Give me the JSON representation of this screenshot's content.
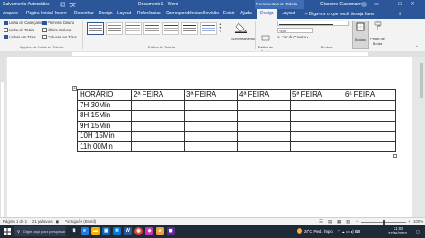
{
  "title_bar": {
    "autosave_label": "Salvamento Automático",
    "document_title": "Documento1 - Word",
    "context_title": "Ferramentas de Tabela",
    "user_name": "Giacomo Giacomann",
    "colors": {
      "bar": "#2b579a",
      "context_band": "#3e6db5"
    }
  },
  "tabs": [
    {
      "label": "Arquivo"
    },
    {
      "label": "Página Inicial"
    },
    {
      "label": "Inserir"
    },
    {
      "label": "Desenhar"
    },
    {
      "label": "Design"
    },
    {
      "label": "Layout"
    },
    {
      "label": "Referências"
    },
    {
      "label": "Correspondências"
    },
    {
      "label": "Revisão"
    },
    {
      "label": "Exibir"
    },
    {
      "label": "Ajuda"
    },
    {
      "label": "Design",
      "active": true
    },
    {
      "label": "Layout"
    }
  ],
  "search": {
    "text": "Diga-me o que você deseja fazer"
  },
  "share": {
    "label": "Compartilhar"
  },
  "ribbon": {
    "style_options": {
      "items": [
        {
          "label": "Linha de Cabeçalho",
          "checked": true
        },
        {
          "label": "Primeira Coluna",
          "checked": true
        },
        {
          "label": "Linha de Totais",
          "checked": false
        },
        {
          "label": "Última Coluna",
          "checked": false
        },
        {
          "label": "Linhas em Tiras",
          "checked": true
        },
        {
          "label": "Colunas em Tiras",
          "checked": false
        }
      ],
      "group_label": "Opções de Estilo de Tabela"
    },
    "table_styles": {
      "group_label": "Estilos de Tabela"
    },
    "shading": {
      "label": "Sombreamento"
    },
    "border_styles": {
      "label": "Estilos de Borda"
    },
    "pen_weight": "½ pt",
    "pen_color": {
      "label": "Cor da Caneta"
    },
    "borders_group_label": "Bordas",
    "borders_button": {
      "label": "Bordas"
    },
    "border_painter": {
      "label": "Pincel de Borda"
    }
  },
  "document": {
    "table": {
      "header": [
        "HORÁRIO",
        "2ª FEIRA",
        "3ª FEIRA",
        "4ª FEIRA",
        "5ª FEIRA",
        "6ª FEIRA"
      ],
      "rows": [
        [
          "7H 30Min",
          "",
          "",
          "",
          "",
          ""
        ],
        [
          "8H 15Min",
          "",
          "",
          "",
          "",
          ""
        ],
        [
          "9H 15Min",
          "",
          "",
          "",
          "",
          ""
        ],
        [
          "10H 15Min",
          "",
          "",
          "",
          "",
          ""
        ],
        [
          "11h 00Min",
          "",
          "",
          "",
          "",
          ""
        ]
      ]
    }
  },
  "status_bar": {
    "page": "Página 1 de 1",
    "words": "21 palavras",
    "language": "Português (Brasil)",
    "zoom": "100%"
  },
  "taskbar": {
    "search_text": "Digite aqui para pesquisar",
    "weather": "26°C  Pred. limpo",
    "time": "21:02",
    "date": "27/06/2022",
    "icons": [
      "windows-icon",
      "search-icon",
      "task-view-icon",
      "edge-icon",
      "file-explorer-icon",
      "store-icon",
      "mail-icon",
      "word-icon",
      "chrome-icon",
      "photos-icon",
      "folder-icon",
      "app-icon"
    ]
  }
}
